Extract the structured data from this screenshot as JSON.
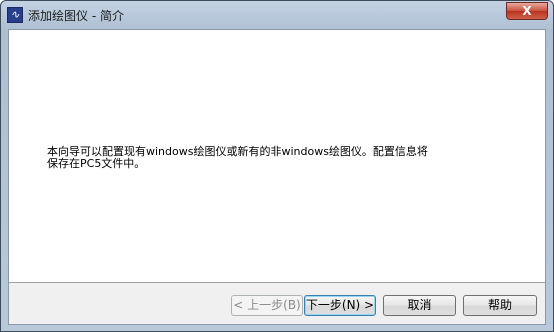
{
  "window": {
    "title": "添加绘图仪 - 简介",
    "close_label": "X"
  },
  "intro": {
    "line1": "本向导可以配置现有windows绘图仪或新有的非windows绘图仪。配置信息将",
    "line2": "保存在PC5文件中。"
  },
  "buttons": {
    "back": "< 上一步(B)",
    "next": "下一步(N) >",
    "cancel": "取消",
    "help": "帮助"
  }
}
